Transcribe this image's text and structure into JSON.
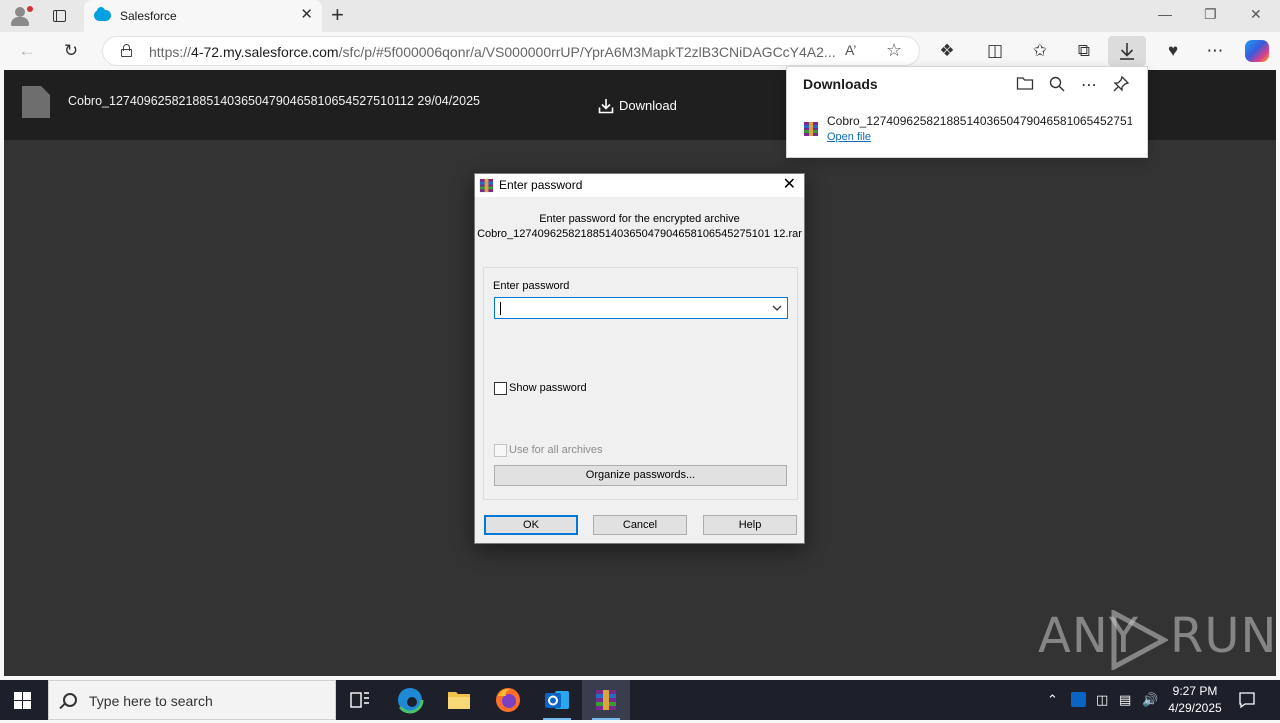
{
  "browser": {
    "tab": {
      "title": "Salesforce",
      "close": "✕"
    },
    "new_tab": "+",
    "window_controls": {
      "minimize": "—",
      "restore": "❐",
      "close": "✕"
    },
    "address": {
      "url_prefix": "https://",
      "url_host": "4-72.my.salesforce.com",
      "url_path": "/sfc/p/#5f000006qonr/a/VS000000rrUP/YprA6M3MapkT2zlB3CNiDAGCcY4A2...",
      "read_aloud": "A’"
    },
    "toolbar_icons": [
      "back-icon",
      "refresh-icon",
      "extensions-icon",
      "split-screen-icon",
      "favorites-icon",
      "collections-icon",
      "downloads-icon",
      "browser-essentials-icon",
      "more-icon",
      "copilot-icon"
    ]
  },
  "page": {
    "file_name": "Cobro_127409625821885140365047904658106545275101​12 29/04/2025",
    "download_label": "Download"
  },
  "downloads": {
    "title": "Downloads",
    "item_name": "Cobro_1274096258218851403650479046581065452751 01...",
    "open_file": "Open file"
  },
  "dialog": {
    "title": "Enter password",
    "message_line1": "Enter password for the encrypted archive",
    "message_line2": "Cobro_127409625821885140365047904658106545275101 12.rar",
    "enter_password_label": "Enter password",
    "password_value": "",
    "show_password_label": "Show password",
    "use_for_all_label": "Use for all archives",
    "organize_label": "Organize passwords...",
    "ok_label": "OK",
    "cancel_label": "Cancel",
    "help_label": "Help",
    "show_password_checked": false,
    "use_for_all_checked": false
  },
  "watermark": {
    "left": "ANY",
    "right": "RUN"
  },
  "taskbar": {
    "search_placeholder": "Type here to search",
    "time": "9:27 PM",
    "date": "4/29/2025",
    "apps": [
      "task-view",
      "edge",
      "file-explorer",
      "firefox",
      "outlook",
      "winrar"
    ]
  },
  "colors": {
    "accent": "#0078d7",
    "page_bg": "#333333",
    "header_bg": "#1f1f1f",
    "link": "#0f6cbd"
  }
}
